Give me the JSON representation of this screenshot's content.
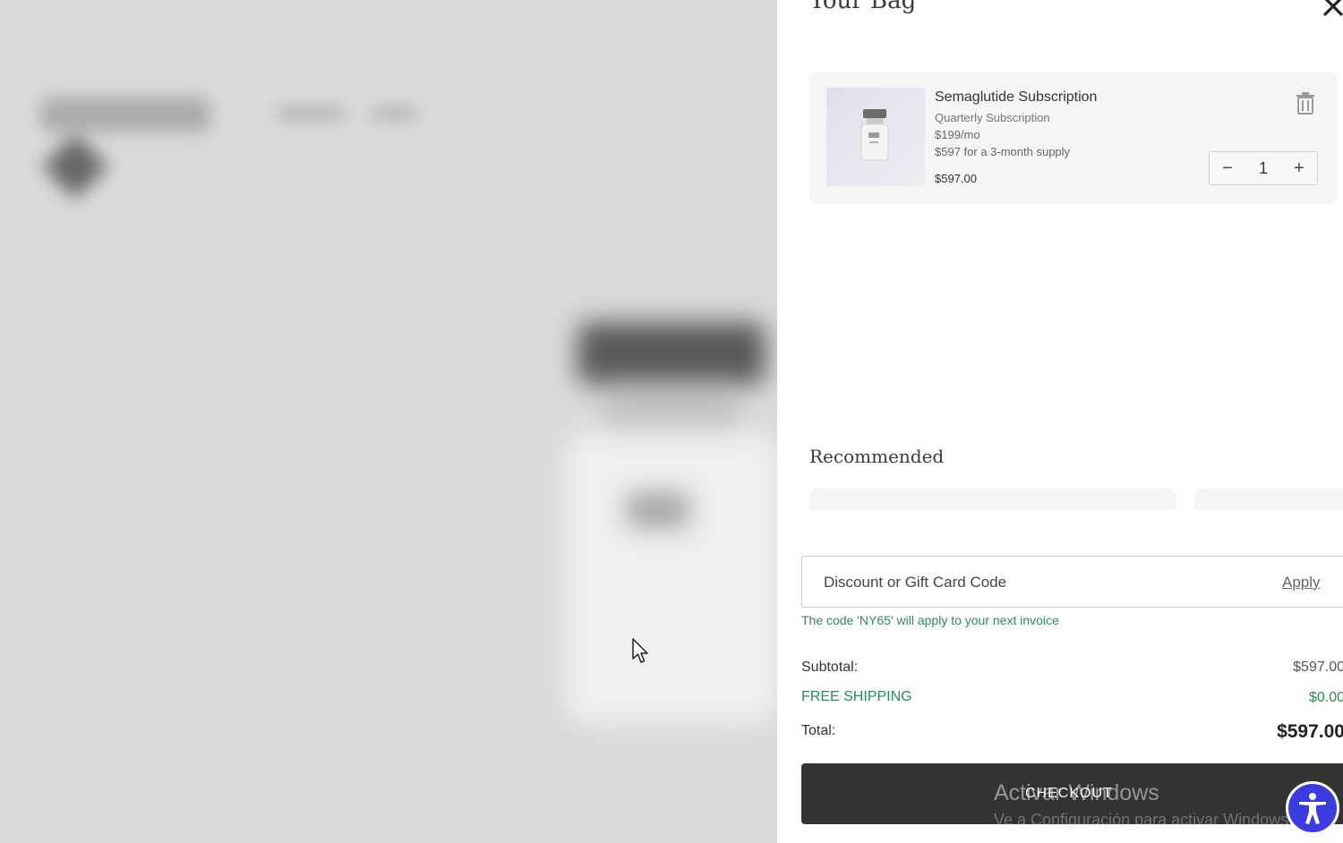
{
  "drawer": {
    "title": "Your Bag",
    "close_icon": "close-icon"
  },
  "cart": {
    "items": [
      {
        "name": "Semaglutide Subscription",
        "plan": "Quarterly Subscription",
        "monthly": "$199/mo",
        "supply": "$597 for a 3-month supply",
        "price": "$597.00",
        "quantity": "1",
        "minus": "−",
        "plus": "+"
      }
    ]
  },
  "recommended": {
    "title": "Recommended"
  },
  "discount": {
    "placeholder": "Discount or Gift Card Code",
    "apply_label": "Apply",
    "message": "The code 'NY65' will apply to your next invoice"
  },
  "summary": {
    "subtotal_label": "Subtotal:",
    "subtotal_value": "$597.00",
    "shipping_label": "FREE SHIPPING",
    "shipping_value": "$0.00",
    "total_label": "Total:",
    "total_value": "$597.00"
  },
  "checkout": {
    "label": "CHECKOUT"
  },
  "watermark": {
    "line1": "Activar Windows",
    "line2": "Ve a Configuración para activar Windows."
  },
  "colors": {
    "accent_green": "#2e8b57",
    "checkout_bg": "#333333",
    "a11y_blue": "#3b3ce0"
  }
}
